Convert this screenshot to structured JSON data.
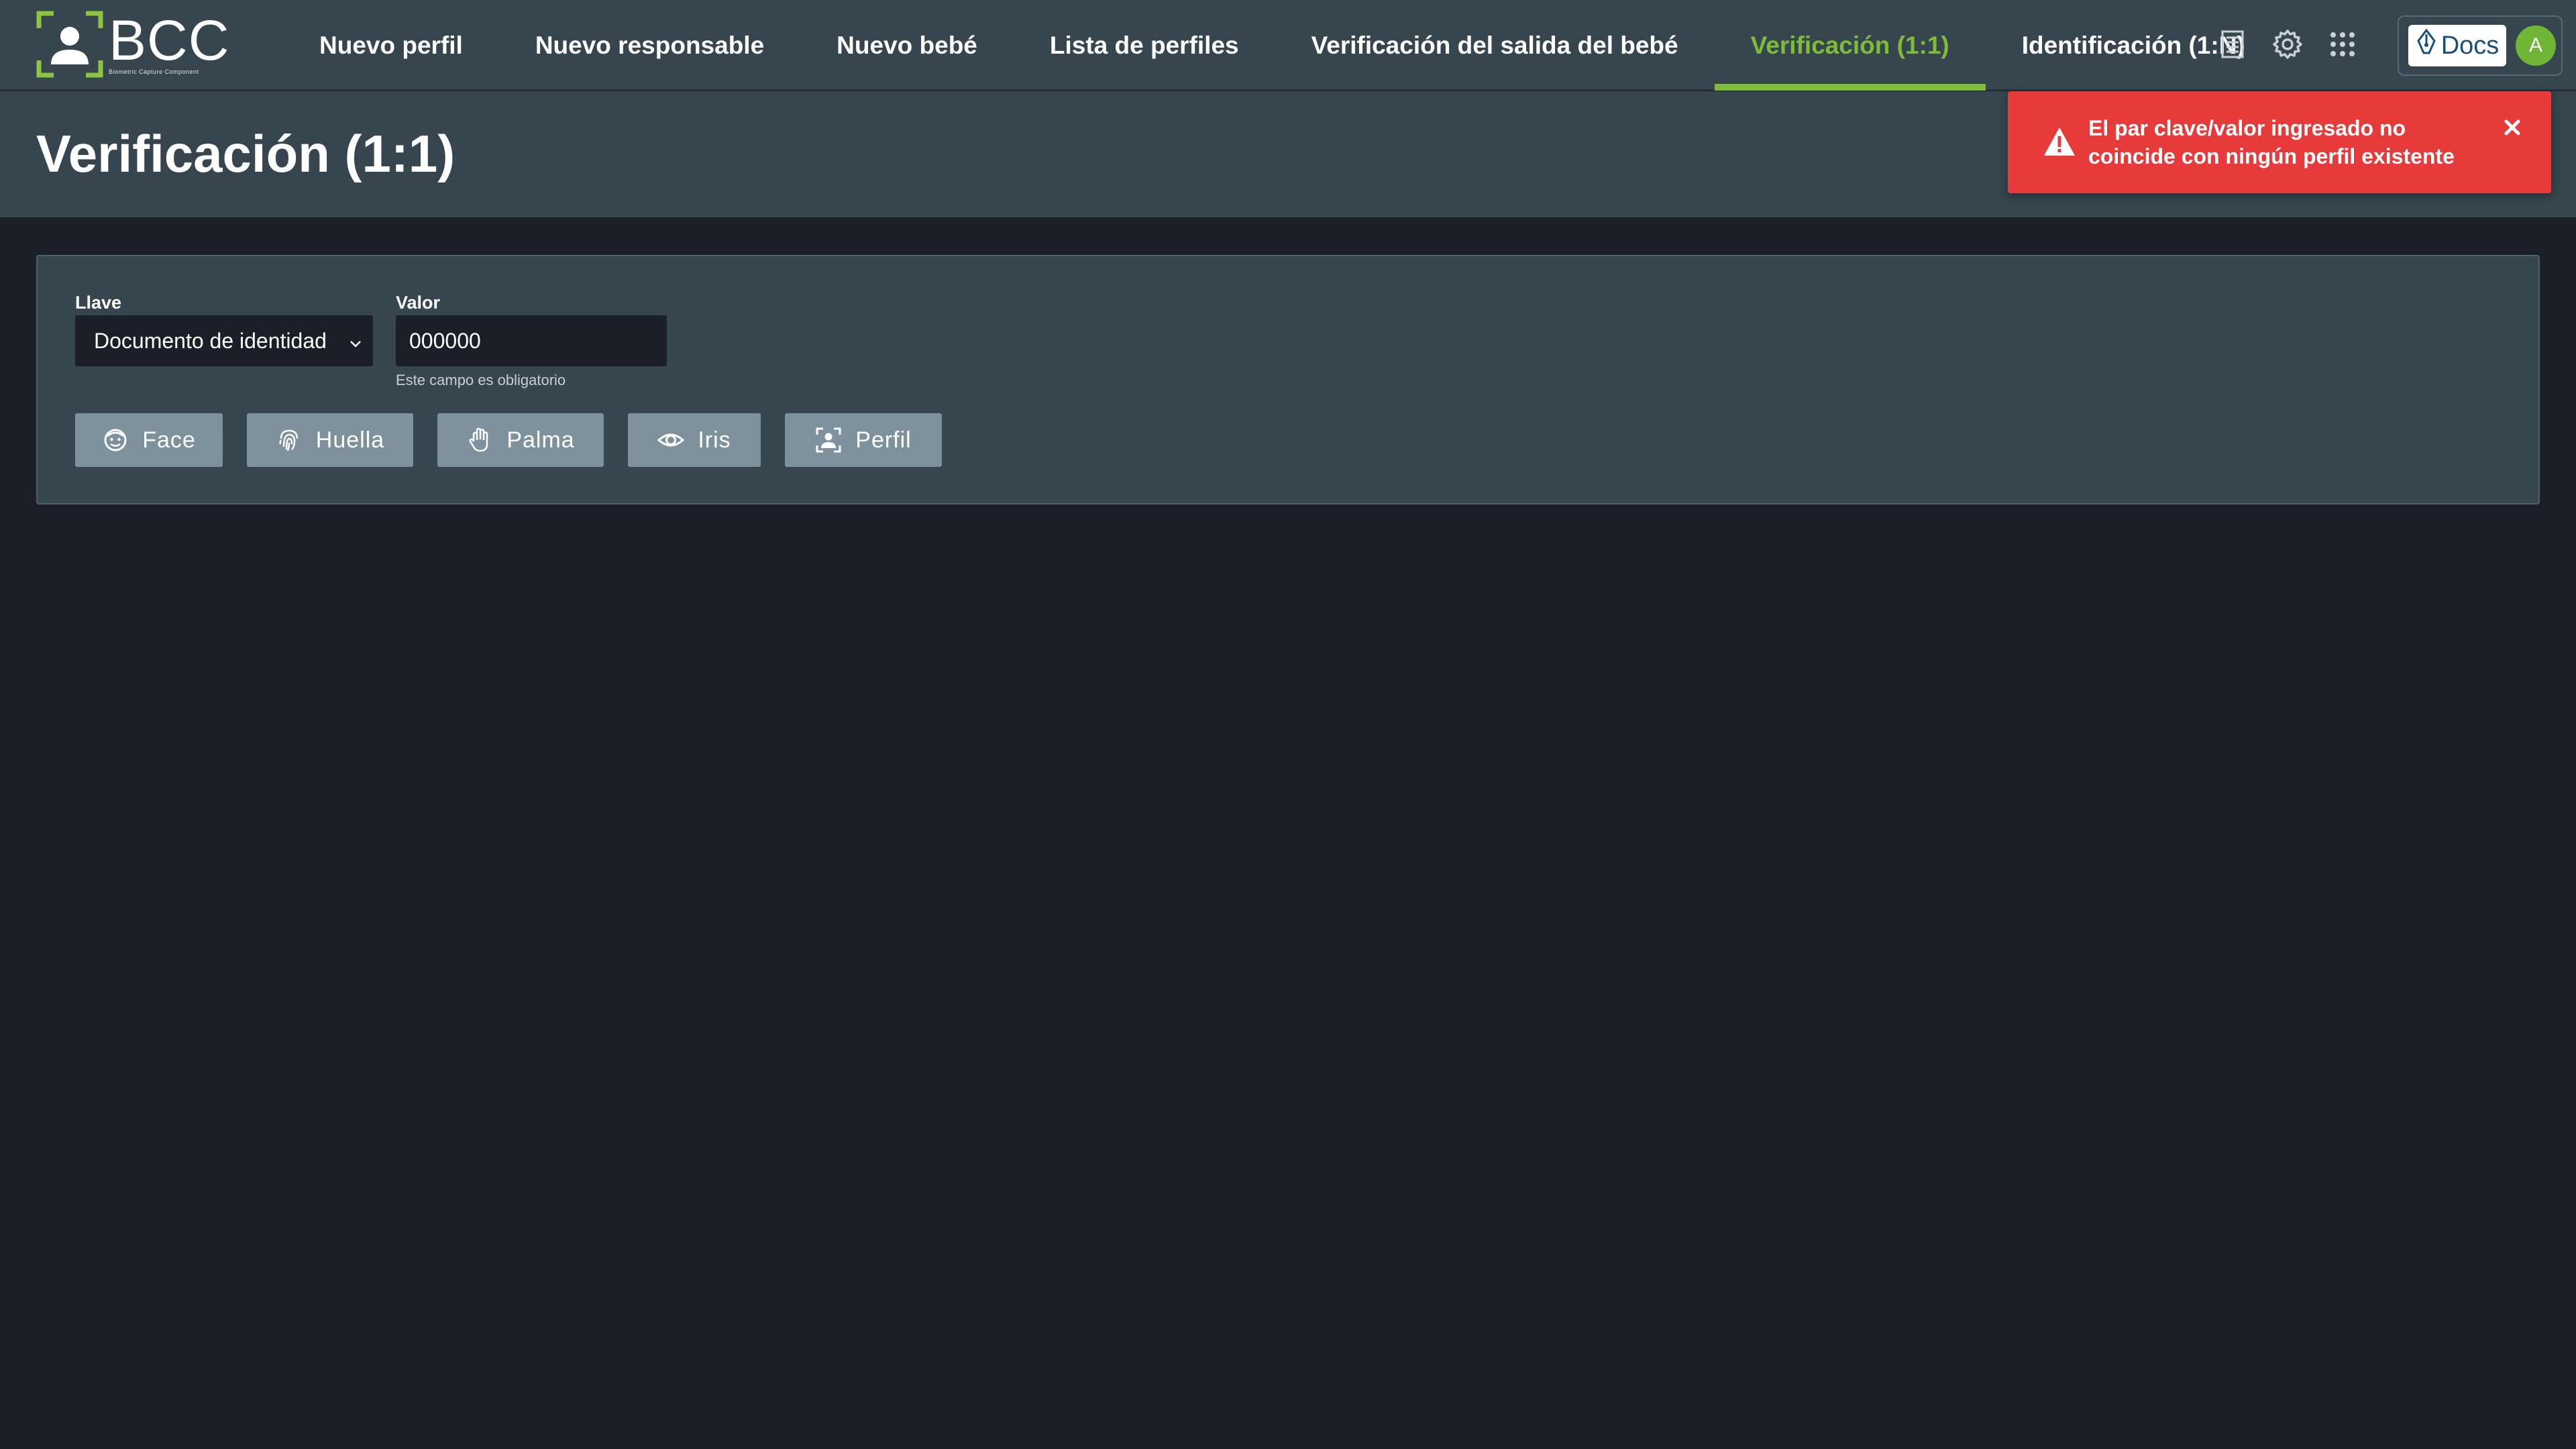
{
  "app": {
    "logo_text": "BCC",
    "logo_subtitle": "Biometric Capture Component"
  },
  "nav": {
    "items": [
      {
        "label": "Nuevo perfil",
        "active": false
      },
      {
        "label": "Nuevo responsable",
        "active": false
      },
      {
        "label": "Nuevo bebé",
        "active": false
      },
      {
        "label": "Lista de perfiles",
        "active": false
      },
      {
        "label": "Verificación del salida del bebé",
        "active": false
      },
      {
        "label": "Verificación (1:1)",
        "active": true
      },
      {
        "label": "Identificación (1:N)",
        "active": false
      }
    ],
    "icons": [
      "document-icon",
      "gear-icon",
      "apps-grid-icon"
    ],
    "docs_label": "Docs",
    "avatar_initial": "A"
  },
  "page": {
    "title": "Verificación (1:1)"
  },
  "toast": {
    "type": "error",
    "message": "El par clave/valor ingresado no coincide con ningún perfil existente"
  },
  "form": {
    "key_label": "Llave",
    "key_value": "Documento de identidad",
    "value_label": "Valor",
    "value_input": "000000",
    "value_helper": "Este campo es obligatorio"
  },
  "buttons": {
    "face": "Face",
    "fingerprint": "Huella",
    "palm": "Palma",
    "iris": "Iris",
    "profile": "Perfil"
  },
  "colors": {
    "accent": "#7dbb38",
    "topbar": "#36454e",
    "background": "#1c1f29",
    "error": "#e73a3a",
    "button": "#7e929e"
  }
}
